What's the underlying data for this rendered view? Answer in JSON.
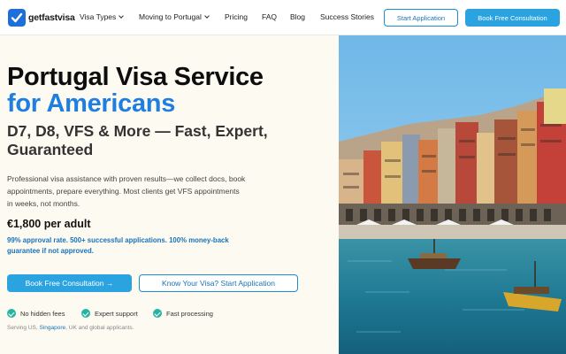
{
  "nav": {
    "logo_text": "getfastvisa",
    "links": [
      "Visa Types",
      "Moving to Portugal",
      "Pricing",
      "FAQ",
      "Blog",
      "Success Stories"
    ],
    "start_application": "Start Application",
    "book_consultation": "Book Free Consultation"
  },
  "hero": {
    "title_line1": "Portugal Visa Service",
    "title_line2": "for Americans",
    "subtitle": "D7, D8, VFS & More — Fast, Expert, Guaranteed",
    "description": "Professional visa assistance with proven results—we collect docs, book appointments, prepare everything. Most clients get VFS appointments in weeks, not months.",
    "price": "€1,800 per adult",
    "guarantee": "99% approval rate. 500+ successful applications. 100% money-back guarantee if not approved.",
    "primary_cta": "Book Free Consultation →",
    "secondary_cta": "Know Your Visa? Start Application",
    "features": [
      "No hidden fees",
      "Expert support",
      "Fast processing"
    ],
    "serving_prefix": "Serving US, ",
    "serving_highlight": "Singapore",
    "serving_suffix": ", UK and global applicants."
  },
  "colors": {
    "accent_blue": "#1f7fe0",
    "button_blue": "#2aa3e0",
    "check_teal": "#27b5a3",
    "background": "#fdfaf1"
  },
  "icons": {
    "logo": "checkmark-badge-icon",
    "dropdown": "chevron-down-icon",
    "feature": "check-circle-icon"
  }
}
